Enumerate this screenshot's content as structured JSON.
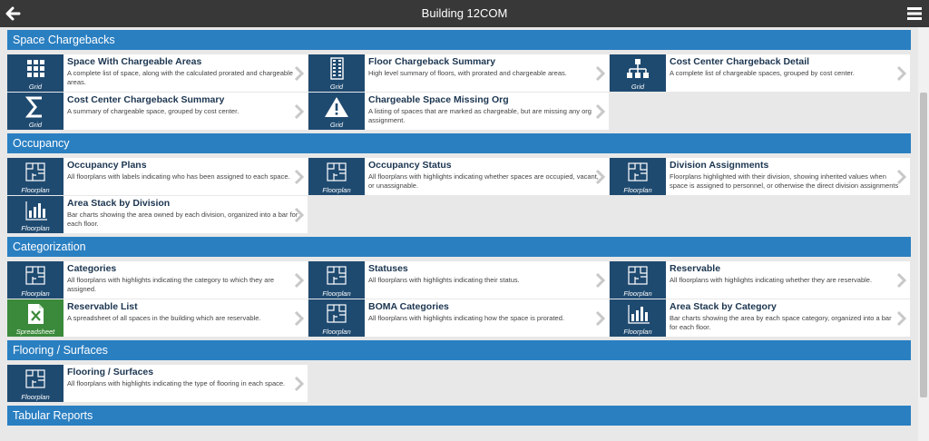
{
  "header": {
    "title": "Building 12COM",
    "back_icon": "back-arrow-icon",
    "menu_icon": "hamburger-menu-icon"
  },
  "colors": {
    "section": "#2a7fc1",
    "tile": "#1f4a70",
    "tile_spreadsheet": "#3b8a3b",
    "topbar": "#383838"
  },
  "sections": [
    {
      "title": "Space Chargebacks",
      "cards": [
        {
          "title": "Space With Chargeable Areas",
          "desc": "A complete list of space, along with the calculated prorated and chargeable areas.",
          "type": "Grid",
          "icon": "grid"
        },
        {
          "title": "Floor Chargeback Summary",
          "desc": "High level summary of floors, with prorated and chargeable areas.",
          "type": "Grid",
          "icon": "building"
        },
        {
          "title": "Cost Center Chargeback Detail",
          "desc": "A complete list of chargeable spaces, grouped by cost center.",
          "type": "Grid",
          "icon": "org"
        },
        {
          "title": "Cost Center Chargeback Summary",
          "desc": "A summary of chargeable space, grouped by cost center.",
          "type": "Grid",
          "icon": "sigma"
        },
        {
          "title": "Chargeable Space Missing Org",
          "desc": "A listing of spaces that are marked as chargeable, but are missing any org assignment.",
          "type": "Grid",
          "icon": "warning"
        }
      ]
    },
    {
      "title": "Occupancy",
      "cards": [
        {
          "title": "Occupancy Plans",
          "desc": "All floorplans with labels indicating who has been assigned to each space.",
          "type": "Floorplan",
          "icon": "floorplan"
        },
        {
          "title": "Occupancy Status",
          "desc": "All floorplans with highlights indicating whether spaces are occupied, vacant, or unassignable.",
          "type": "Floorplan",
          "icon": "floorplan"
        },
        {
          "title": "Division Assignments",
          "desc": "Floorplans highlighted with their division, showing inherited values when space is assigned to personnel, or otherwise the direct division assignments if set.",
          "type": "Floorplan",
          "icon": "floorplan"
        },
        {
          "title": "Area Stack by Division",
          "desc": "Bar charts showing the area owned by each division, organized into a bar for each floor.",
          "type": "Floorplan",
          "icon": "barchart"
        }
      ]
    },
    {
      "title": "Categorization",
      "cards": [
        {
          "title": "Categories",
          "desc": "All floorplans with highlights indicating the category to which they are assigned.",
          "type": "Floorplan",
          "icon": "floorplan"
        },
        {
          "title": "Statuses",
          "desc": "All floorplans with highlights indicating their status.",
          "type": "Floorplan",
          "icon": "floorplan"
        },
        {
          "title": "Reservable",
          "desc": "All floorplans with highlights indicating whether they are reservable.",
          "type": "Floorplan",
          "icon": "floorplan"
        },
        {
          "title": "Reservable List",
          "desc": "A spreadsheet of all spaces in the building which are reservable.",
          "type": "Spreadsheet",
          "icon": "spreadsheet"
        },
        {
          "title": "BOMA Categories",
          "desc": "All floorplans with highlights indicating how the space is prorated.",
          "type": "Floorplan",
          "icon": "floorplan"
        },
        {
          "title": "Area Stack by Category",
          "desc": "Bar charts showing the area by each space category, organized into a bar for each floor.",
          "type": "Floorplan",
          "icon": "barchart"
        }
      ]
    },
    {
      "title": "Flooring / Surfaces",
      "cards": [
        {
          "title": "Flooring / Surfaces",
          "desc": "All floorplans with highlights indicating the type of flooring in each space.",
          "type": "Floorplan",
          "icon": "floorplan"
        }
      ]
    },
    {
      "title": "Tabular Reports",
      "cards": []
    }
  ]
}
